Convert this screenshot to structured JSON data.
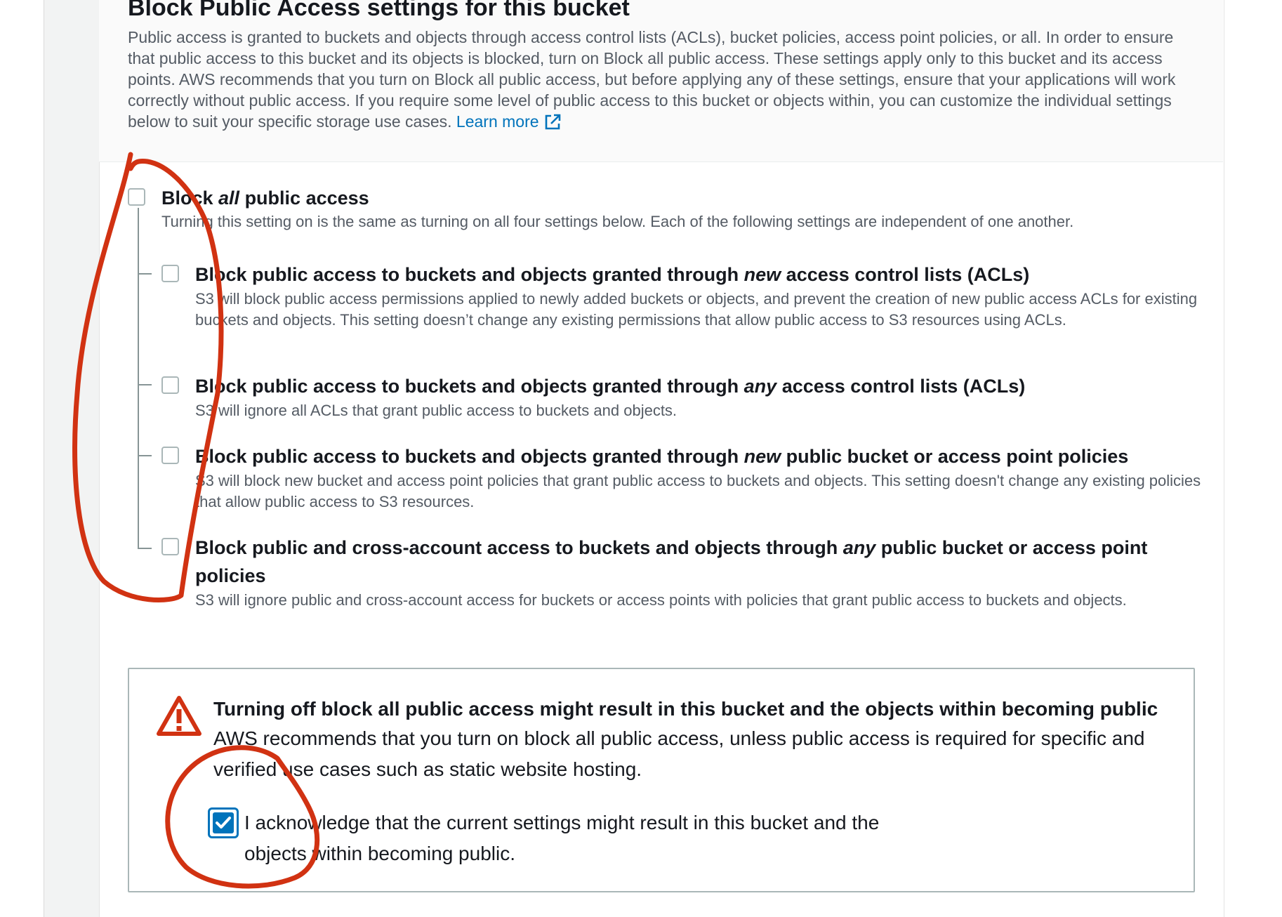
{
  "section": {
    "title": "Block Public Access settings for this bucket",
    "description": "Public access is granted to buckets and objects through access control lists (ACLs), bucket policies, access point policies, or all. In order to ensure that public access to this bucket and its objects is blocked, turn on Block all public access. These settings apply only to this bucket and its access points. AWS recommends that you turn on Block all public access, but before applying any of these settings, ensure that your applications will work correctly without public access. If you require some level of public access to this bucket or objects within, you can customize the individual settings below to suit your specific storage use cases.",
    "learn_more": "Learn more"
  },
  "block_all": {
    "label_pre": "Block ",
    "label_em": "all",
    "label_post": " public access",
    "description": "Turning this setting on is the same as turning on all four settings below. Each of the following settings are independent of one another.",
    "checked": false
  },
  "options": [
    {
      "label_pre": "Block public access to buckets and objects granted through ",
      "label_em": "new",
      "label_post": " access control lists (ACLs)",
      "description": "S3 will block public access permissions applied to newly added buckets or objects, and prevent the creation of new public access ACLs for existing buckets and objects. This setting doesn’t change any existing permissions that allow public access to S3 resources using ACLs.",
      "checked": false
    },
    {
      "label_pre": "Block public access to buckets and objects granted through ",
      "label_em": "any",
      "label_post": " access control lists (ACLs)",
      "description": "S3 will ignore all ACLs that grant public access to buckets and objects.",
      "checked": false
    },
    {
      "label_pre": "Block public access to buckets and objects granted through ",
      "label_em": "new",
      "label_post": " public bucket or access point policies",
      "description": "S3 will block new bucket and access point policies that grant public access to buckets and objects. This setting doesn't change any existing policies that allow public access to S3 resources.",
      "checked": false
    },
    {
      "label_pre": "Block public and cross-account access to buckets and objects through ",
      "label_em": "any",
      "label_post": " public bucket or access point policies",
      "description": "S3 will ignore public and cross-account access for buckets or access points with policies that grant public access to buckets and objects.",
      "checked": false
    }
  ],
  "warning": {
    "title": "Turning off block all public access might result in this bucket and the objects within becoming public",
    "body": "AWS recommends that you turn on block all public access, unless public access is required for specific and verified use cases such as static website hosting.",
    "acknowledge": "I acknowledge that the current settings might result in this bucket and the objects within becoming public.",
    "acknowledged": true
  },
  "colors": {
    "link": "#0073bb",
    "warning_icon": "#d13212",
    "annotation": "#d13212",
    "checkbox_checked": "#0073bb"
  },
  "icons": {
    "learn_more": "external-link-icon",
    "warning": "warning-triangle-icon",
    "checked": "checkmark-icon"
  }
}
